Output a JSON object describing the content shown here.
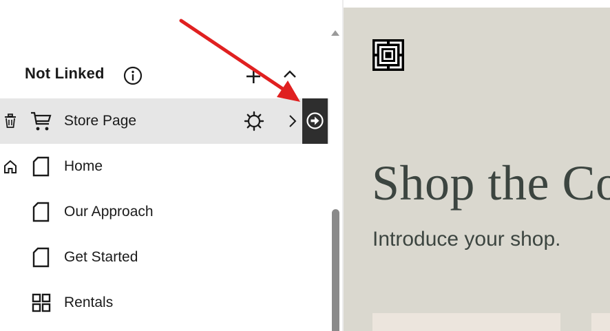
{
  "sidebar": {
    "section": {
      "title": "Not Linked",
      "info_icon": "info-circle-icon",
      "add_icon": "plus-icon",
      "collapse_icon": "chevron-up-icon"
    },
    "pages": [
      {
        "label": "Store Page",
        "icon": "cart-icon",
        "selected": true,
        "lead_icon": "trash-icon"
      },
      {
        "label": "Home",
        "icon": "page-icon",
        "selected": false,
        "lead_icon": "home-icon"
      },
      {
        "label": "Our Approach",
        "icon": "page-icon",
        "selected": false
      },
      {
        "label": "Get Started",
        "icon": "page-icon",
        "selected": false
      },
      {
        "label": "Rentals",
        "icon": "grid-icon",
        "selected": false
      }
    ]
  },
  "preview": {
    "hero_title": "Shop the Co",
    "hero_subtitle": "Introduce your shop.",
    "background_color": "#dad8cf",
    "text_color": "#3c4540"
  },
  "annotation": {
    "arrow_color": "#e02020"
  },
  "colors": {
    "selected_row": "#e6e6e6",
    "open_button": "#2e2e2e"
  }
}
